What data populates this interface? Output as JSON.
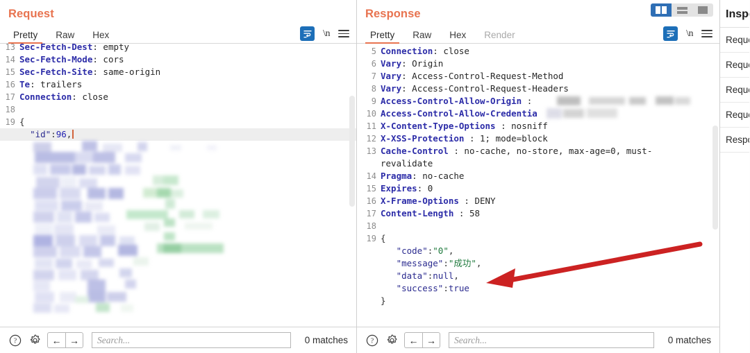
{
  "request": {
    "title": "Request",
    "tabs": [
      {
        "label": "Pretty",
        "active": true
      },
      {
        "label": "Raw",
        "active": false
      },
      {
        "label": "Hex",
        "active": false
      }
    ],
    "tools": {
      "wrap_icon": "word-wrap-icon",
      "newline_label": "\\n",
      "menu_icon": "hamburger-menu-icon"
    },
    "lines": [
      {
        "num": "13",
        "name": "Sec-Fetch-Dest",
        "sep": ": ",
        "value": "empty",
        "clipped": true
      },
      {
        "num": "14",
        "name": "Sec-Fetch-Mode",
        "sep": ": ",
        "value": "cors"
      },
      {
        "num": "15",
        "name": "Sec-Fetch-Site",
        "sep": ": ",
        "value": "same-origin"
      },
      {
        "num": "16",
        "name": "Te",
        "sep": ": ",
        "value": "trailers"
      },
      {
        "num": "17",
        "name": "Connection",
        "sep": ": ",
        "value": "close"
      },
      {
        "num": "18",
        "name": "",
        "sep": "",
        "value": ""
      },
      {
        "num": "19",
        "name": "",
        "sep": "",
        "value": "{"
      }
    ],
    "body_line": {
      "key": "\"id\"",
      "colon": ":",
      "value": "96",
      "comma": ",",
      "highlighted": true
    },
    "body_redacted_note": "redacted-json-body",
    "footer": {
      "help_icon": "help-circle-icon",
      "settings_icon": "gear-icon",
      "back_icon": "arrow-left-icon",
      "forward_icon": "arrow-right-icon",
      "search_placeholder": "Search...",
      "search_value": "",
      "matches": "0 matches"
    }
  },
  "response": {
    "title": "Response",
    "layout_buttons": [
      {
        "name": "split-vertical-layout",
        "active": true
      },
      {
        "name": "split-horizontal-layout",
        "active": false
      },
      {
        "name": "single-pane-layout",
        "active": false
      }
    ],
    "tabs": [
      {
        "label": "Pretty",
        "active": true
      },
      {
        "label": "Raw",
        "active": false
      },
      {
        "label": "Hex",
        "active": false
      },
      {
        "label": "Render",
        "active": false,
        "disabled": true
      }
    ],
    "tools": {
      "wrap_icon": "word-wrap-icon",
      "newline_label": "\\n",
      "menu_icon": "hamburger-menu-icon"
    },
    "lines": [
      {
        "num": "5",
        "name": "Connection",
        "sep": ": ",
        "value": "close"
      },
      {
        "num": "6",
        "name": "Vary",
        "sep": ": ",
        "value": "Origin"
      },
      {
        "num": "7",
        "name": "Vary",
        "sep": ": ",
        "value": "Access-Control-Request-Method"
      },
      {
        "num": "8",
        "name": "Vary",
        "sep": ": ",
        "value": "Access-Control-Request-Headers"
      },
      {
        "num": "9",
        "name": "Access-Control-Allow-Origin",
        "sep": " : ",
        "value": "",
        "redacted": true
      },
      {
        "num": "10",
        "name": "Access-Control-Allow-Credentia",
        "sep": "",
        "value": "",
        "redacted": true
      },
      {
        "num": "11",
        "name": "X-Content-Type-Options",
        "sep": " : ",
        "value": "nosniff"
      },
      {
        "num": "12",
        "name": "X-XSS-Protection",
        "sep": " : ",
        "value": "1; mode=block"
      },
      {
        "num": "13",
        "name": "Cache-Control",
        "sep": " : ",
        "value": "no-cache, no-store, max-age=0, must-revalidate"
      },
      {
        "num": "14",
        "name": "Pragma",
        "sep": ": ",
        "value": "no-cache"
      },
      {
        "num": "15",
        "name": "Expires",
        "sep": ": ",
        "value": "0"
      },
      {
        "num": "16",
        "name": "X-Frame-Options",
        "sep": " : ",
        "value": "DENY"
      },
      {
        "num": "17",
        "name": "Content-Length",
        "sep": " : ",
        "value": "58"
      },
      {
        "num": "18",
        "name": "",
        "sep": "",
        "value": ""
      },
      {
        "num": "19",
        "name": "",
        "sep": "",
        "value": "{"
      }
    ],
    "body": [
      {
        "key": "\"code\"",
        "colon": ":",
        "value": "\"0\"",
        "type": "string",
        "comma": ","
      },
      {
        "key": "\"message\"",
        "colon": ":",
        "value": "\"成功\"",
        "type": "string",
        "comma": ","
      },
      {
        "key": "\"data\"",
        "colon": ":",
        "value": "null",
        "type": "literal",
        "comma": ","
      },
      {
        "key": "\"success\"",
        "colon": ":",
        "value": "true",
        "type": "literal",
        "comma": ""
      }
    ],
    "body_close": "}",
    "footer": {
      "help_icon": "help-circle-icon",
      "settings_icon": "gear-icon",
      "back_icon": "arrow-left-icon",
      "forward_icon": "arrow-right-icon",
      "search_placeholder": "Search...",
      "search_value": "",
      "matches": "0 matches"
    }
  },
  "inspector": {
    "title": "Inspector",
    "items": [
      {
        "label": "Request"
      },
      {
        "label": "Request"
      },
      {
        "label": "Request"
      },
      {
        "label": "Request"
      },
      {
        "label": "Response"
      }
    ]
  },
  "annotation": {
    "type": "red-arrow",
    "color": "#cc2222",
    "points_at": "\"message\":\"成功\""
  },
  "colors": {
    "heading": "#e8734f",
    "header_name": "#2c2ca8",
    "json_string": "#1f7a3d",
    "json_number": "#1f1fb0",
    "accent_button": "#1d6fb8",
    "arrow": "#cc2222"
  }
}
